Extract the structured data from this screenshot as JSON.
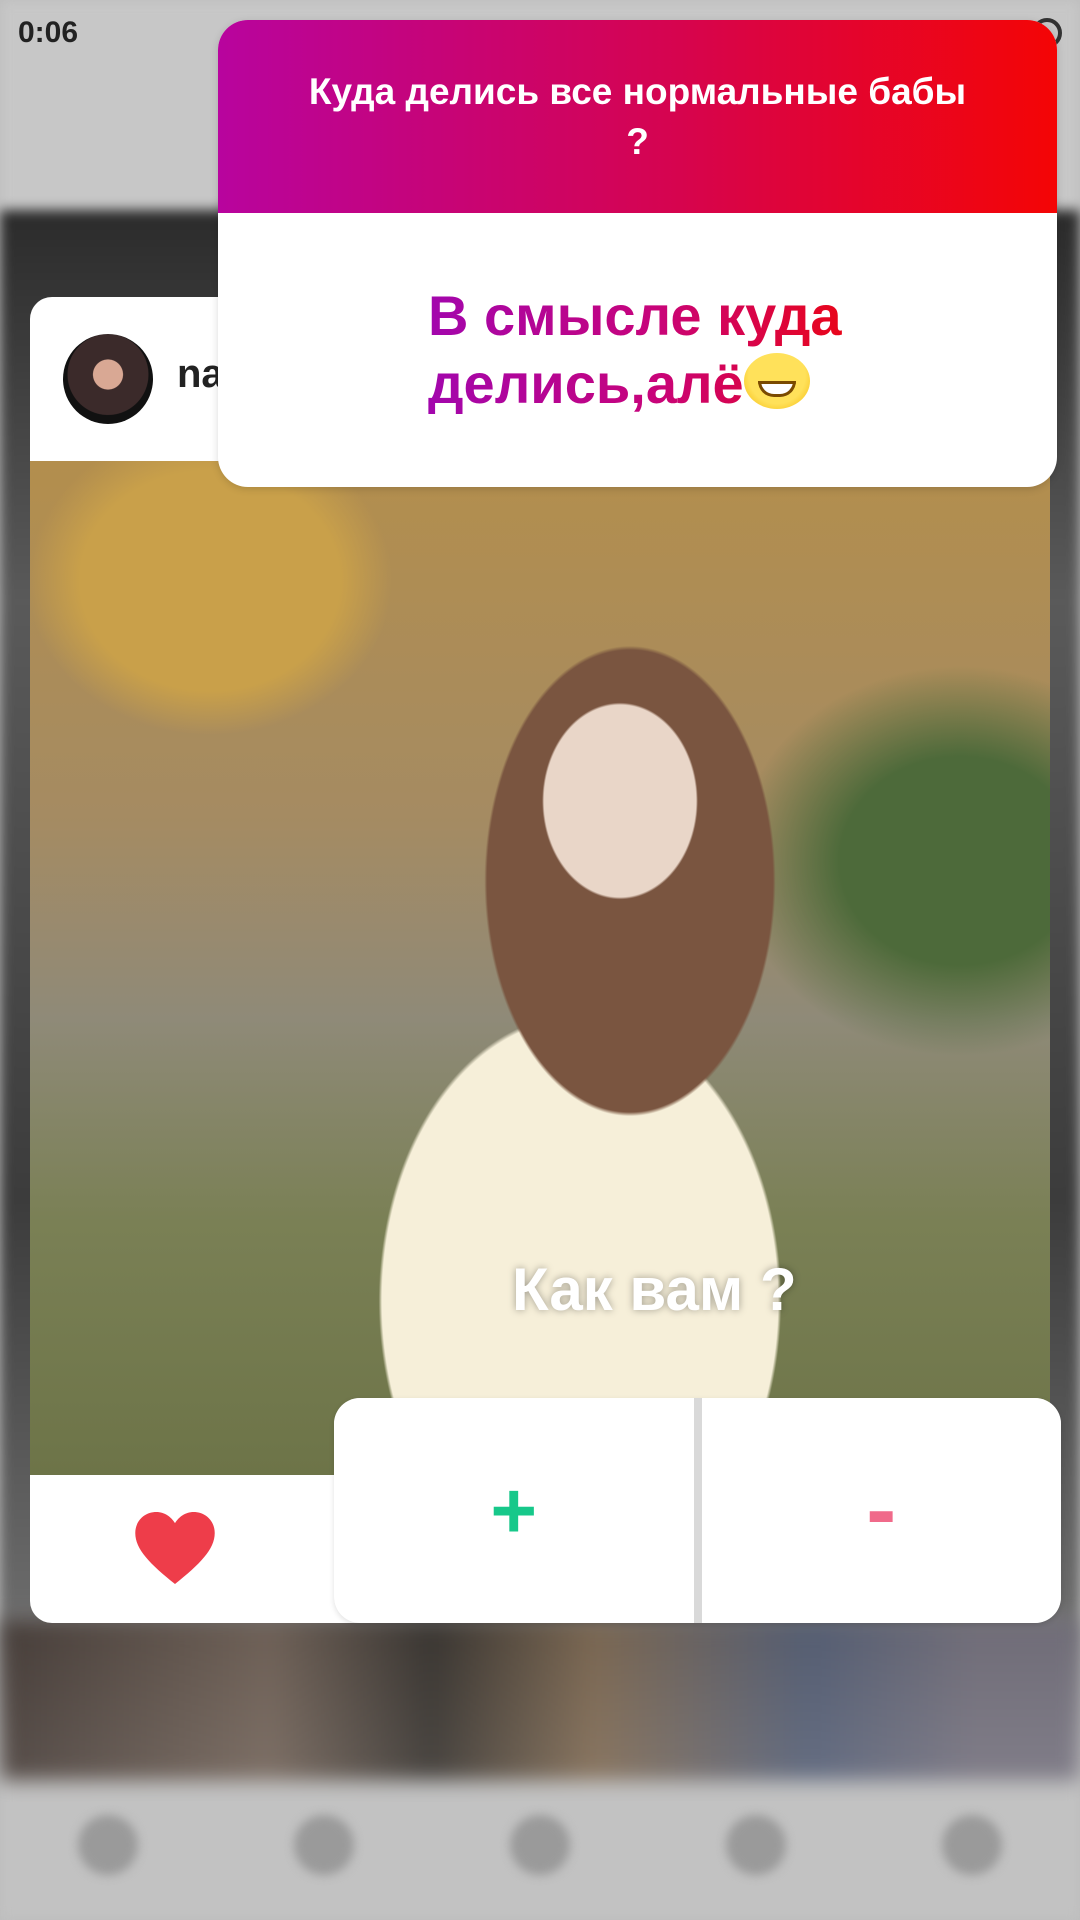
{
  "status_bar": {
    "time": "0:06"
  },
  "post": {
    "username": "na",
    "caption": "Как вам ?"
  },
  "question_sticker": {
    "question": "Куда делись все нормальные бабы ?",
    "answer_line1": "В смысле куда",
    "answer_line2": "делись,алё",
    "answer_emoji": "grinning-squinting-face"
  },
  "poll_sticker": {
    "options": [
      "+",
      "-"
    ]
  },
  "colors": {
    "question_gradient_start": "#b8049e",
    "question_gradient_end": "#f40505",
    "poll_plus": "#17c88a",
    "poll_minus": "#f06a8a",
    "heart": "#ee3d4a"
  }
}
